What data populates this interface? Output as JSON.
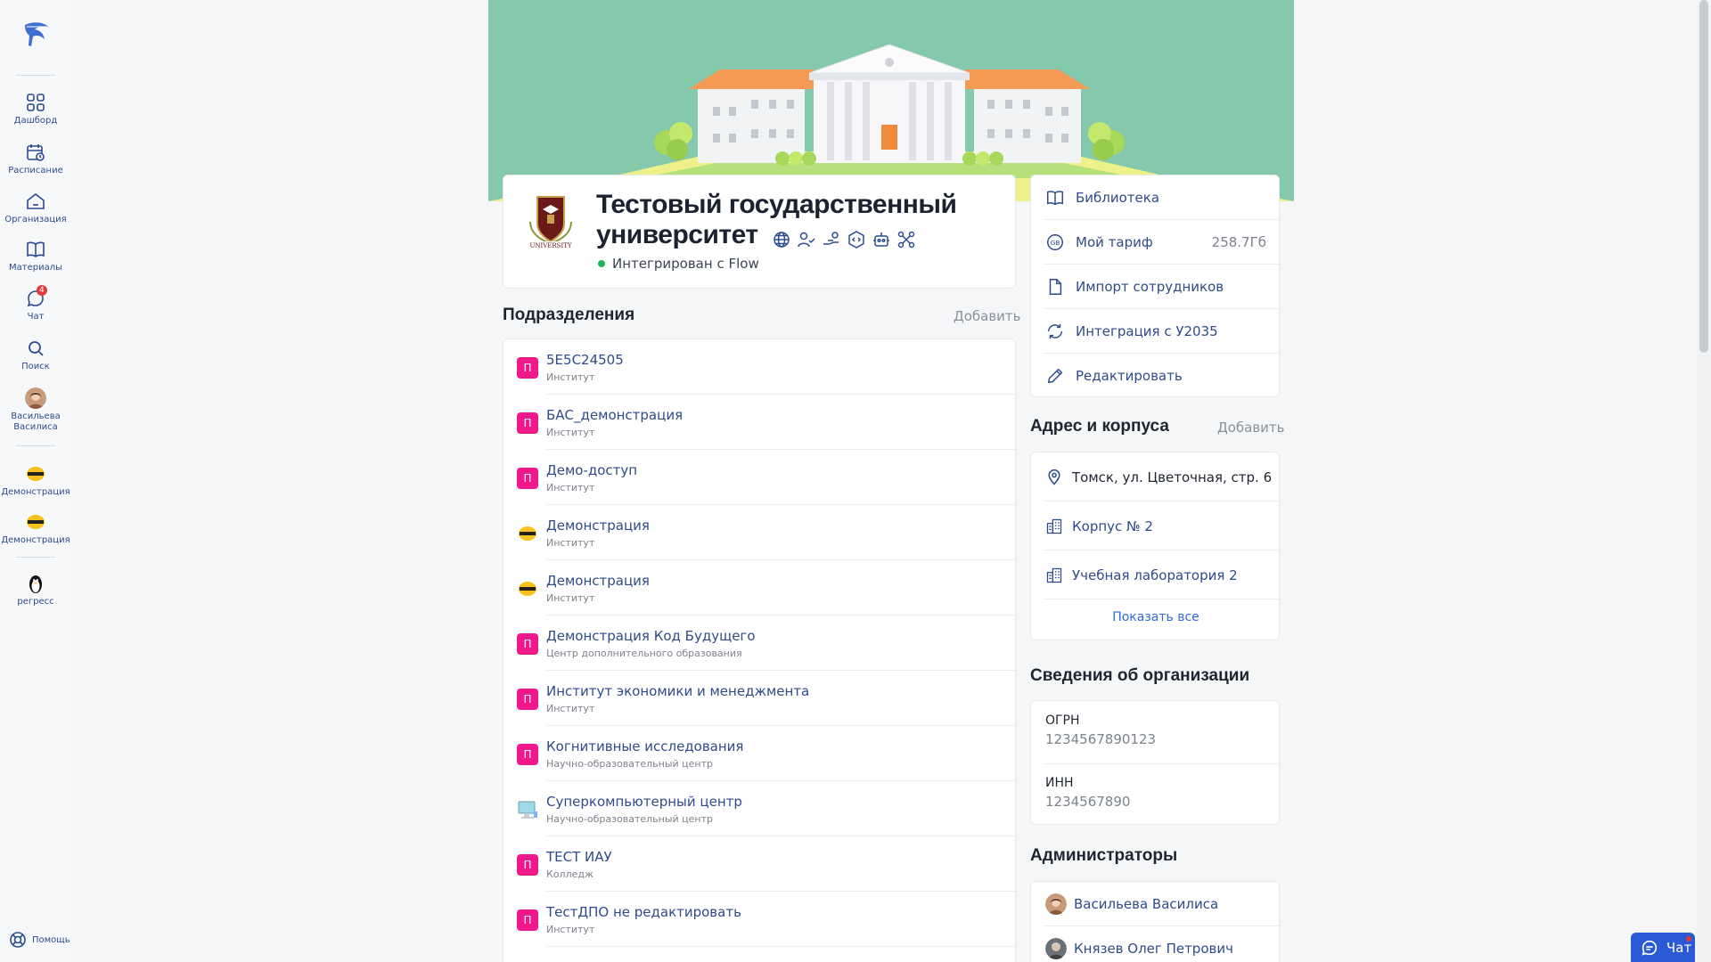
{
  "sidebar": {
    "items": [
      {
        "label": "Дашборд",
        "icon": "grid-icon"
      },
      {
        "label": "Расписание",
        "icon": "calendar-clock-icon"
      },
      {
        "label": "Организация",
        "icon": "home-icon"
      },
      {
        "label": "Материалы",
        "icon": "book-icon"
      },
      {
        "label": "Чат",
        "icon": "chat-icon",
        "badge": "4"
      },
      {
        "label": "Поиск",
        "icon": "search-icon"
      },
      {
        "label": "Васильева Василиса",
        "icon": "avatar"
      }
    ],
    "orgs": [
      {
        "label": "Демонстрация"
      },
      {
        "label": "Демонстрация"
      },
      {
        "label": "регресс"
      }
    ],
    "help_label": "Помощь"
  },
  "org": {
    "title": "Тестовый государственный университет",
    "integration": "Интегрирован с Flow",
    "title_icons": [
      "globe-icon",
      "user-check-icon",
      "hand-icon",
      "code-icon",
      "robot-icon",
      "network-icon"
    ]
  },
  "departments": {
    "heading": "Подразделения",
    "add_label": "Добавить",
    "rows": [
      {
        "name": "5E5C24505",
        "type": "Институт",
        "icon": "П"
      },
      {
        "name": "БАС_демонстрация",
        "type": "Институт",
        "icon": "П"
      },
      {
        "name": "Демо-доступ",
        "type": "Институт",
        "icon": "П"
      },
      {
        "name": "Демонстрация",
        "type": "Институт",
        "icon": "logo"
      },
      {
        "name": "Демонстрация",
        "type": "Институт",
        "icon": "logo"
      },
      {
        "name": "Демонстрация Код Будущего",
        "type": "Центр дополнительного образования",
        "icon": "П"
      },
      {
        "name": "Институт экономики и менеджмента",
        "type": "Институт",
        "icon": "П"
      },
      {
        "name": "Когнитивные исследования",
        "type": "Научно-образовательный центр",
        "icon": "П"
      },
      {
        "name": "Суперкомпьютерный центр",
        "type": "Научно-образовательный центр",
        "icon": "computer"
      },
      {
        "name": "ТЕСТ ИАУ",
        "type": "Колледж",
        "icon": "П"
      },
      {
        "name": "ТестДПО не редактировать",
        "type": "Институт",
        "icon": "П"
      }
    ]
  },
  "actions": [
    {
      "label": "Библиотека",
      "icon": "book-icon"
    },
    {
      "label": "Мой тариф",
      "icon": "gb-icon",
      "value": "258.7Гб"
    },
    {
      "label": "Импорт сотрудников",
      "icon": "file-icon"
    },
    {
      "label": "Интеграция с У2035",
      "icon": "sync-icon"
    },
    {
      "label": "Редактировать",
      "icon": "pencil-icon"
    }
  ],
  "address": {
    "heading": "Адрес и корпуса",
    "add_label": "Добавить",
    "rows": [
      {
        "label": "Томск, ул. Цветочная, стр. 6",
        "icon": "map-pin-icon"
      },
      {
        "label": "Корпус № 2",
        "icon": "building-icon"
      },
      {
        "label": "Учебная лаборатория 2",
        "icon": "building-icon"
      }
    ],
    "show_all": "Показать все"
  },
  "info": {
    "heading": "Сведения об организации",
    "rows": [
      {
        "label": "ОГРН",
        "value": "1234567890123"
      },
      {
        "label": "ИНН",
        "value": "1234567890"
      }
    ]
  },
  "admins": {
    "heading": "Администраторы",
    "rows": [
      {
        "name": "Васильева Василиса"
      },
      {
        "name": "Князев Олег Петрович"
      }
    ]
  },
  "chat_widget": {
    "label": "Чат"
  },
  "colors": {
    "accent": "#2f4b8a",
    "banner": "#84c9ab",
    "pink": "#f0188a",
    "link": "#2f6ad6"
  }
}
